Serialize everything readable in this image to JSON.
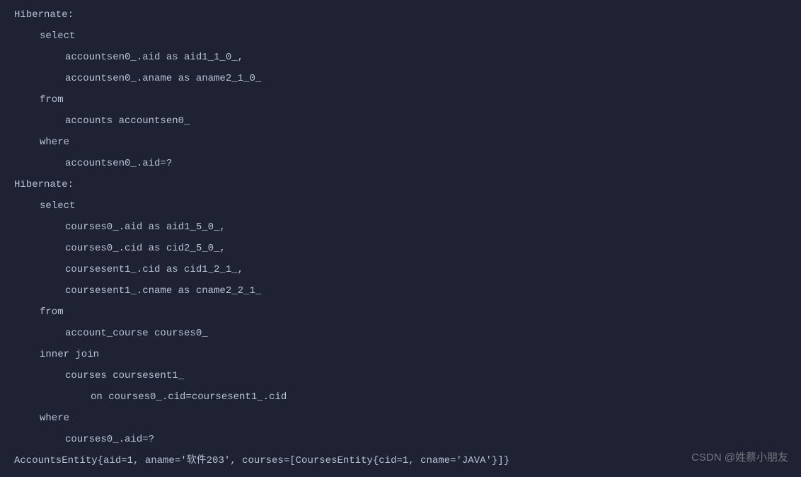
{
  "lines": [
    {
      "indent": 0,
      "text": "Hibernate:"
    },
    {
      "indent": 1,
      "text": "select"
    },
    {
      "indent": 2,
      "text": "accountsen0_.aid as aid1_1_0_,"
    },
    {
      "indent": 2,
      "text": "accountsen0_.aname as aname2_1_0_"
    },
    {
      "indent": 1,
      "text": "from"
    },
    {
      "indent": 2,
      "text": "accounts accountsen0_"
    },
    {
      "indent": 1,
      "text": "where"
    },
    {
      "indent": 2,
      "text": "accountsen0_.aid=?"
    },
    {
      "indent": 0,
      "text": "Hibernate:"
    },
    {
      "indent": 1,
      "text": "select"
    },
    {
      "indent": 2,
      "text": "courses0_.aid as aid1_5_0_,"
    },
    {
      "indent": 2,
      "text": "courses0_.cid as cid2_5_0_,"
    },
    {
      "indent": 2,
      "text": "coursesent1_.cid as cid1_2_1_,"
    },
    {
      "indent": 2,
      "text": "coursesent1_.cname as cname2_2_1_"
    },
    {
      "indent": 1,
      "text": "from"
    },
    {
      "indent": 2,
      "text": "account_course courses0_"
    },
    {
      "indent": 1,
      "text": "inner join"
    },
    {
      "indent": 2,
      "text": "courses coursesent1_"
    },
    {
      "indent": 3,
      "text": "on courses0_.cid=coursesent1_.cid"
    },
    {
      "indent": 1,
      "text": "where"
    },
    {
      "indent": 2,
      "text": "courses0_.aid=?"
    },
    {
      "indent": 0,
      "text": "AccountsEntity{aid=1, aname='软件203', courses=[CoursesEntity{cid=1, cname='JAVA'}]}"
    }
  ],
  "watermark": "CSDN @姓蔡小朋友"
}
